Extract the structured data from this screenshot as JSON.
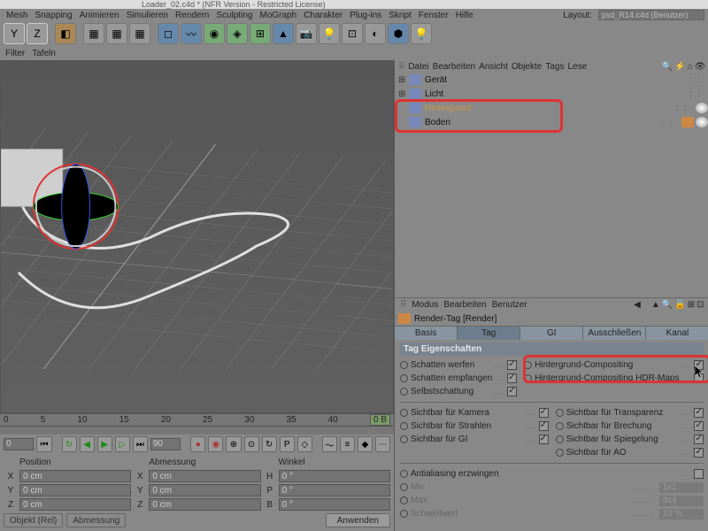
{
  "title": "Loader_02.c4d * (NFR Version - Restricted License)",
  "menu": [
    "Mesh",
    "Snapping",
    "Animieren",
    "Simulieren",
    "Rendern",
    "Sculpting",
    "MoGraph",
    "Charakter",
    "Plug-ins",
    "Skript",
    "Fenster",
    "Hilfe"
  ],
  "layout_label": "Layout:",
  "layout_value": "psd_R14.c4d (Benutzer)",
  "subbar": [
    "Filter",
    "Tafeln"
  ],
  "timeline": {
    "start": "0",
    "end": "40",
    "indicator": "0 B",
    "field1": "0",
    "field2": "90"
  },
  "coords": {
    "headers": [
      "Position",
      "Abmessung",
      "Winkel"
    ],
    "rows": [
      {
        "a": "X",
        "av": "0 cm",
        "b": "X",
        "bv": "0 cm",
        "c": "H",
        "cv": "0 °"
      },
      {
        "a": "Y",
        "av": "0 cm",
        "b": "Y",
        "bv": "0 cm",
        "c": "P",
        "cv": "0 °"
      },
      {
        "a": "Z",
        "av": "0 cm",
        "b": "Z",
        "bv": "0 cm",
        "c": "B",
        "cv": "0 °"
      }
    ],
    "mode": "Objekt (Rel)",
    "dim": "Abmessung",
    "apply": "Anwenden"
  },
  "obj_menu": [
    "Datei",
    "Bearbeiten",
    "Ansicht",
    "Objekte",
    "Tags",
    "Lese"
  ],
  "tree": [
    {
      "exp": "⊞",
      "name": "Gerät",
      "sel": false,
      "tags": []
    },
    {
      "exp": "⊞",
      "name": "Licht",
      "sel": false,
      "tags": []
    },
    {
      "exp": "",
      "name": "Hintergrund",
      "sel": true,
      "tags": [
        "s"
      ]
    },
    {
      "exp": "",
      "name": "Boden",
      "sel": false,
      "tags": [
        "r",
        "s"
      ]
    }
  ],
  "attr_menu": [
    "Modus",
    "Bearbeiten",
    "Benutzer"
  ],
  "attr_title": "Render-Tag [Render]",
  "tabs": [
    "Basis",
    "Tag",
    "GI",
    "Ausschließen",
    "Kanal"
  ],
  "tabs_active": 1,
  "section": "Tag Eigenschaften",
  "props_l1": [
    {
      "l": "Schatten werfen",
      "c": true
    },
    {
      "l": "Schatten empfangen",
      "c": true
    },
    {
      "l": "Selbstschattung",
      "c": true
    }
  ],
  "props_r1": [
    {
      "l": "Hintergrund-Compositing",
      "c": true
    },
    {
      "l": "Hintergrund-Compositing HDR-Maps",
      "c": false
    }
  ],
  "props_l2": [
    {
      "l": "Sichtbar für Kamera",
      "c": true
    },
    {
      "l": "Sichtbar für Strahlen",
      "c": true
    },
    {
      "l": "Sichtbar für GI",
      "c": true
    }
  ],
  "props_r2": [
    {
      "l": "Sichtbar für Transparenz",
      "c": true
    },
    {
      "l": "Sichtbar für Brechung",
      "c": true
    },
    {
      "l": "Sichtbar für Spiegelung",
      "c": true
    },
    {
      "l": "Sichtbar für AO",
      "c": true
    }
  ],
  "props_bot": [
    {
      "l": "Antialiasing erzwingen",
      "c": false,
      "type": "chk"
    },
    {
      "l": "Min",
      "v": "1x1",
      "dim": true
    },
    {
      "l": "Max",
      "v": "4x4",
      "dim": true
    },
    {
      "l": "Schwellwert",
      "v": "10 %",
      "dim": true
    }
  ]
}
